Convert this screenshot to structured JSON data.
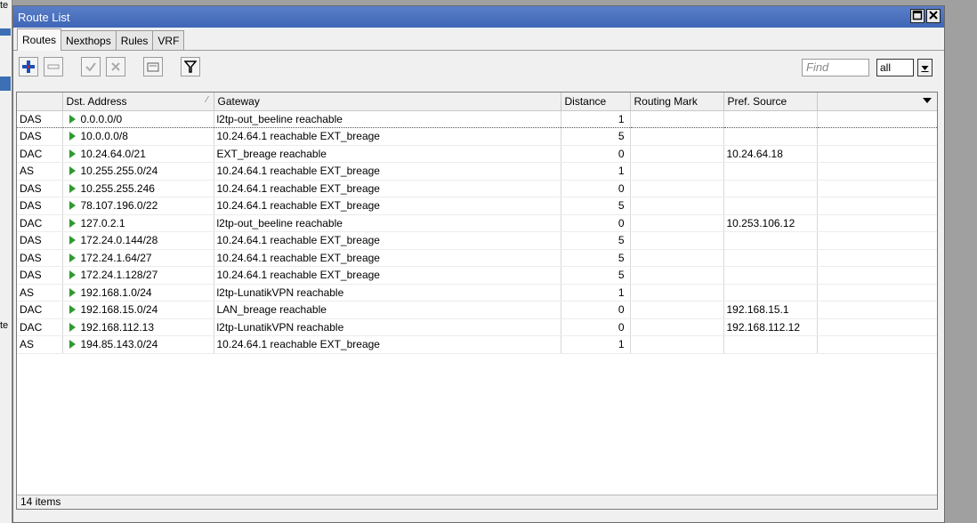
{
  "window": {
    "title": "Route List"
  },
  "background": {
    "left_fragments": [
      "te",
      "te"
    ]
  },
  "tabs": [
    {
      "label": "Routes",
      "active": true
    },
    {
      "label": "Nexthops",
      "active": false
    },
    {
      "label": "Rules",
      "active": false
    },
    {
      "label": "VRF",
      "active": false
    }
  ],
  "toolbar": {
    "add_icon": "plus-icon",
    "remove_icon": "minus-icon",
    "enable_icon": "check-icon",
    "disable_icon": "x-icon",
    "comment_icon": "comment-icon",
    "filter_icon": "filter-icon",
    "find_placeholder": "Find",
    "filter_select": "all"
  },
  "table": {
    "columns": [
      "",
      "Dst. Address",
      "Gateway",
      "Distance",
      "Routing Mark",
      "Pref. Source",
      ""
    ],
    "rows": [
      {
        "flags": "DAS",
        "dst": "0.0.0.0/0",
        "gateway": "l2tp-out_beeline reachable",
        "distance": "1",
        "mark": "",
        "pref": ""
      },
      {
        "flags": "DAS",
        "dst": "10.0.0.0/8",
        "gateway": "10.24.64.1 reachable EXT_breage",
        "distance": "5",
        "mark": "",
        "pref": ""
      },
      {
        "flags": "DAC",
        "dst": "10.24.64.0/21",
        "gateway": "EXT_breage reachable",
        "distance": "0",
        "mark": "",
        "pref": "10.24.64.18"
      },
      {
        "flags": "AS",
        "dst": "10.255.255.0/24",
        "gateway": "10.24.64.1 reachable EXT_breage",
        "distance": "1",
        "mark": "",
        "pref": ""
      },
      {
        "flags": "DAS",
        "dst": "10.255.255.246",
        "gateway": "10.24.64.1 reachable EXT_breage",
        "distance": "0",
        "mark": "",
        "pref": ""
      },
      {
        "flags": "DAS",
        "dst": "78.107.196.0/22",
        "gateway": "10.24.64.1 reachable EXT_breage",
        "distance": "5",
        "mark": "",
        "pref": ""
      },
      {
        "flags": "DAC",
        "dst": "127.0.2.1",
        "gateway": "l2tp-out_beeline reachable",
        "distance": "0",
        "mark": "",
        "pref": "10.253.106.12"
      },
      {
        "flags": "DAS",
        "dst": "172.24.0.144/28",
        "gateway": "10.24.64.1 reachable EXT_breage",
        "distance": "5",
        "mark": "",
        "pref": ""
      },
      {
        "flags": "DAS",
        "dst": "172.24.1.64/27",
        "gateway": "10.24.64.1 reachable EXT_breage",
        "distance": "5",
        "mark": "",
        "pref": ""
      },
      {
        "flags": "DAS",
        "dst": "172.24.1.128/27",
        "gateway": "10.24.64.1 reachable EXT_breage",
        "distance": "5",
        "mark": "",
        "pref": ""
      },
      {
        "flags": "AS",
        "dst": "192.168.1.0/24",
        "gateway": "l2tp-LunatikVPN reachable",
        "distance": "1",
        "mark": "",
        "pref": ""
      },
      {
        "flags": "DAC",
        "dst": "192.168.15.0/24",
        "gateway": "LAN_breage reachable",
        "distance": "0",
        "mark": "",
        "pref": "192.168.15.1"
      },
      {
        "flags": "DAC",
        "dst": "192.168.112.13",
        "gateway": "l2tp-LunatikVPN reachable",
        "distance": "0",
        "mark": "",
        "pref": "192.168.112.12"
      },
      {
        "flags": "AS",
        "dst": "194.85.143.0/24",
        "gateway": "10.24.64.1 reachable EXT_breage",
        "distance": "1",
        "mark": "",
        "pref": ""
      }
    ]
  },
  "status": {
    "item_count": "14 items"
  }
}
